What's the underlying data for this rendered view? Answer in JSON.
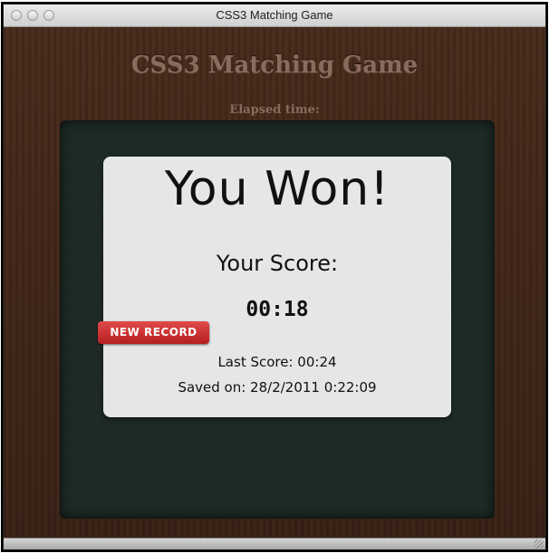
{
  "window": {
    "title": "CSS3 Matching Game"
  },
  "game": {
    "title": "CSS3 Matching Game",
    "elapsed_label": "Elapsed time:"
  },
  "result": {
    "headline": "You Won!",
    "score_label": "Your Score:",
    "score_value": "00:18",
    "badge": "NEW RECORD",
    "last_score": "Last Score: 00:24",
    "saved_on": "Saved on: 28/2/2011 0:22:09"
  },
  "colors": {
    "badge": "#c92e2e",
    "board": "#1b2824",
    "background": "#3a2418",
    "popup": "#e6e6e6"
  },
  "icons": {
    "close": "close-button",
    "minimize": "minimize-button",
    "zoom": "zoom-button",
    "resize": "resize-grip-icon"
  }
}
